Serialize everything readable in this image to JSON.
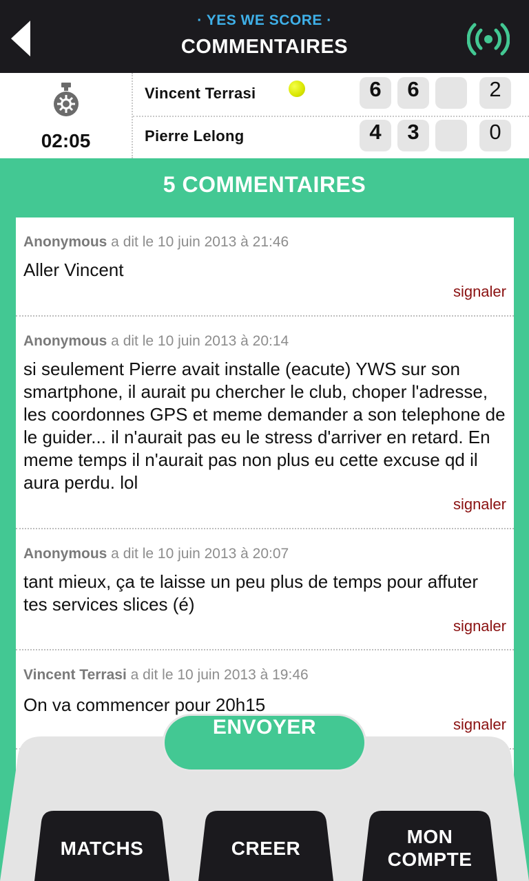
{
  "header": {
    "brand": "· YES WE SCORE ·",
    "title": "COMMENTAIRES",
    "back_icon": "back-arrow-icon",
    "live_icon": "broadcast-icon",
    "accent": "#43c893",
    "brand_color": "#3fb0e8"
  },
  "match": {
    "timer": "02:05",
    "server": "Vincent Terrasi",
    "players": [
      {
        "name": "Vincent Terrasi",
        "sets": [
          "6",
          "6",
          ""
        ],
        "points": "2"
      },
      {
        "name": "Pierre Lelong",
        "sets": [
          "4",
          "3",
          ""
        ],
        "points": "0"
      }
    ]
  },
  "comments_header": "5 COMMENTAIRES",
  "comments": [
    {
      "author": "Anonymous",
      "meta": " a dit le 10 juin 2013 à 21:46",
      "text": "Aller Vincent",
      "report": "signaler"
    },
    {
      "author": "Anonymous",
      "meta": " a dit le 10 juin 2013 à 20:14",
      "text": "si seulement Pierre avait installe (eacute) YWS sur son smartphone, il aurait pu chercher le club, choper l'adresse, les coordonnes GPS et meme demander a son telephone de le guider... il n'aurait pas eu le stress d'arriver en retard. En meme temps il n'aurait pas non plus eu cette excuse qd il aura perdu. lol",
      "report": "signaler"
    },
    {
      "author": "Anonymous",
      "meta": " a dit le 10 juin 2013 à 20:07",
      "text": "tant mieux, ça te laisse un peu plus de temps pour affuter tes services slices (é)",
      "report": "signaler"
    },
    {
      "author": "Vincent Terrasi",
      "meta": " a dit le 10 juin 2013 à 19:46",
      "text": "On va commencer pour 20h15",
      "report": "signaler"
    }
  ],
  "send_button": "ENVOYER",
  "nav": {
    "matchs": "MATCHS",
    "creer": "CREER",
    "compte_line1": "MON",
    "compte_line2": "COMPTE"
  }
}
